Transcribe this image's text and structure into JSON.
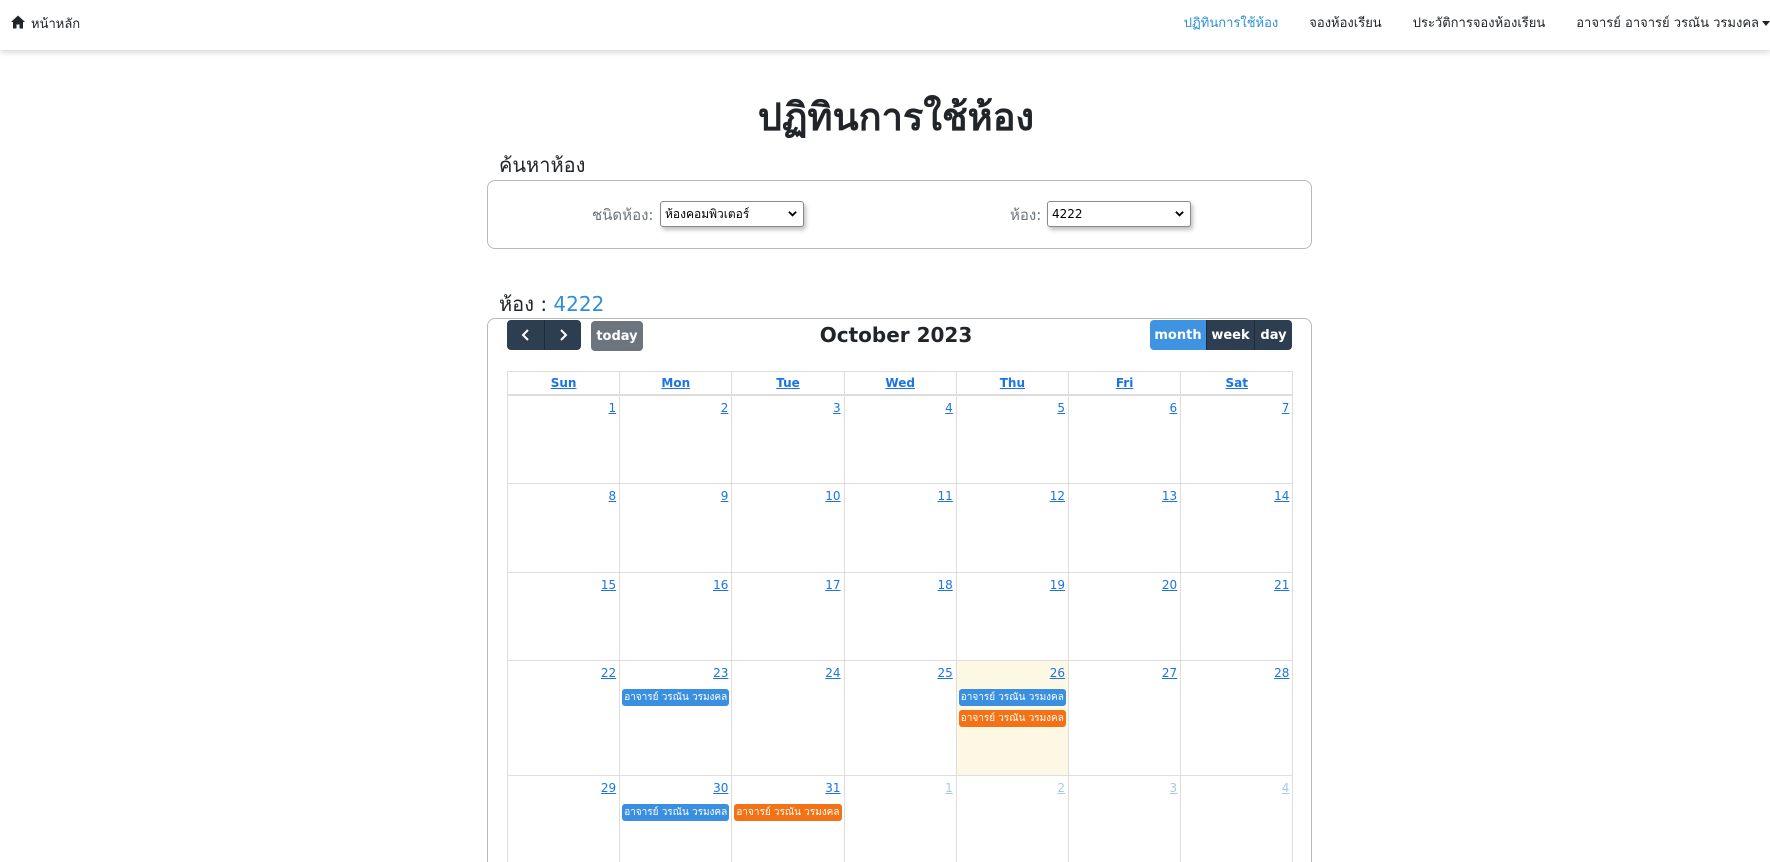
{
  "nav": {
    "brand": "หน้าหลัก",
    "links": [
      "ปฏิทินการใช้ห้อง",
      "จองห้องเรียน",
      "ประวัติการจองห้องเรียน",
      "อาจารย์ อาจารย์ วรณัน วรมงคล"
    ]
  },
  "page": {
    "title": "ปฏิทินการใช้ห้อง"
  },
  "search": {
    "heading": "ค้นหาห้อง",
    "room_type_label": "ชนิดห้อง:",
    "room_type_value": "ห้องคอมพิวเตอร์",
    "room_label": "ห้อง:",
    "room_value": "4222"
  },
  "room_display": {
    "label": "ห้อง : ",
    "value": "4222"
  },
  "calendar": {
    "title": "October 2023",
    "today_label": "today",
    "views": [
      "month",
      "week",
      "day"
    ],
    "active_view": "month",
    "weekdays": [
      "Sun",
      "Mon",
      "Tue",
      "Wed",
      "Thu",
      "Fri",
      "Sat"
    ],
    "weeks": [
      [
        "1",
        "2",
        "3",
        "4",
        "5",
        "6",
        "7"
      ],
      [
        "8",
        "9",
        "10",
        "11",
        "12",
        "13",
        "14"
      ],
      [
        "15",
        "16",
        "17",
        "18",
        "19",
        "20",
        "21"
      ],
      [
        "22",
        "23",
        "24",
        "25",
        "26",
        "27",
        "28"
      ],
      [
        "29",
        "30",
        "31",
        "1",
        "2",
        "3",
        "4"
      ]
    ],
    "today_date": "26",
    "events": [
      {
        "date": "23",
        "title": "อาจารย์ วรณัน วรมงคล",
        "color": "#3a8fe0"
      },
      {
        "date": "26",
        "title": "อาจารย์ วรณัน วรมงคล",
        "color": "#3a8fe0"
      },
      {
        "date": "26",
        "title": "อาจารย์ วรณัน วรมงคล",
        "color": "#f47216"
      },
      {
        "date": "30",
        "title": "อาจารย์ วรณัน วรมงคล",
        "color": "#3a8fe0"
      },
      {
        "date": "31",
        "title": "อาจารย์ วรณัน วรมงคล",
        "color": "#f47216"
      }
    ]
  },
  "colors": {
    "accent": "#2f8fd8",
    "dark_button": "#2c3e50",
    "today_bg": "#fcf8e3"
  }
}
